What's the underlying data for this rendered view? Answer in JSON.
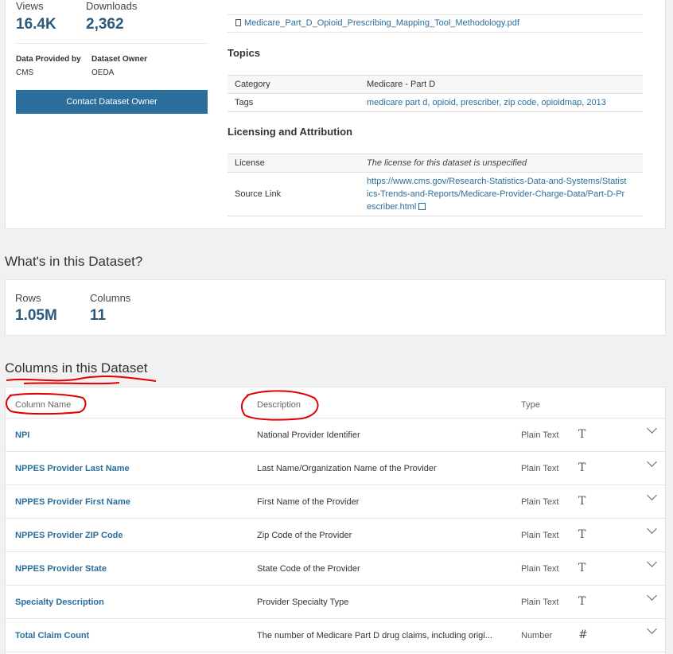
{
  "sidebar": {
    "views_label": "Views",
    "views_value": "16.4K",
    "downloads_label": "Downloads",
    "downloads_value": "2,362",
    "provided_by_label": "Data Provided by",
    "provided_by_value": "CMS",
    "owner_label": "Dataset Owner",
    "owner_value": "OEDA",
    "contact_label": "Contact Dataset Owner"
  },
  "attachment": {
    "filename": "Medicare_Part_D_Opioid_Prescribing_Mapping_Tool_Methodology.pdf"
  },
  "topics": {
    "title": "Topics",
    "category_key": "Category",
    "category_value": "Medicare - Part D",
    "tags_key": "Tags",
    "tags_value": "medicare part d, opioid, prescriber, zip code, opioidmap, 2013"
  },
  "licensing": {
    "title": "Licensing and Attribution",
    "license_key": "License",
    "license_value": "The license for this dataset is unspecified",
    "source_key": "Source Link",
    "source_line1": "https://www.cms.gov/Research-Statistics-Data-and-Systems/Statist",
    "source_line2": "ics-Trends-and-Reports/Medicare-Provider-Charge-Data/Part-D-Pr",
    "source_line3": "escriber.html"
  },
  "dataset": {
    "title": "What's in this Dataset?",
    "rows_label": "Rows",
    "rows_value": "1.05M",
    "columns_label": "Columns",
    "columns_value": "11"
  },
  "columns": {
    "title": "Columns in this Dataset",
    "head_name": "Column Name",
    "head_desc": "Description",
    "head_type": "Type",
    "rows": [
      {
        "name": "NPI",
        "desc": "National Provider Identifier",
        "type": "Plain Text",
        "icon": "T"
      },
      {
        "name": "NPPES Provider Last Name",
        "desc": "Last Name/Organization Name of the Provider",
        "type": "Plain Text",
        "icon": "T"
      },
      {
        "name": "NPPES Provider First Name",
        "desc": "First Name of the Provider",
        "type": "Plain Text",
        "icon": "T"
      },
      {
        "name": "NPPES Provider ZIP Code",
        "desc": "Zip Code of the Provider",
        "type": "Plain Text",
        "icon": "T"
      },
      {
        "name": "NPPES Provider State",
        "desc": "State Code of the Provider",
        "type": "Plain Text",
        "icon": "T"
      },
      {
        "name": "Specialty Description",
        "desc": "Provider Specialty Type",
        "type": "Plain Text",
        "icon": "T"
      },
      {
        "name": "Total Claim Count",
        "desc": "The number of Medicare Part D drug claims, including origi...",
        "type": "Number",
        "icon": "#"
      }
    ]
  },
  "colors": {
    "accent": "#2a6f9b",
    "annotation": "#e00000"
  }
}
